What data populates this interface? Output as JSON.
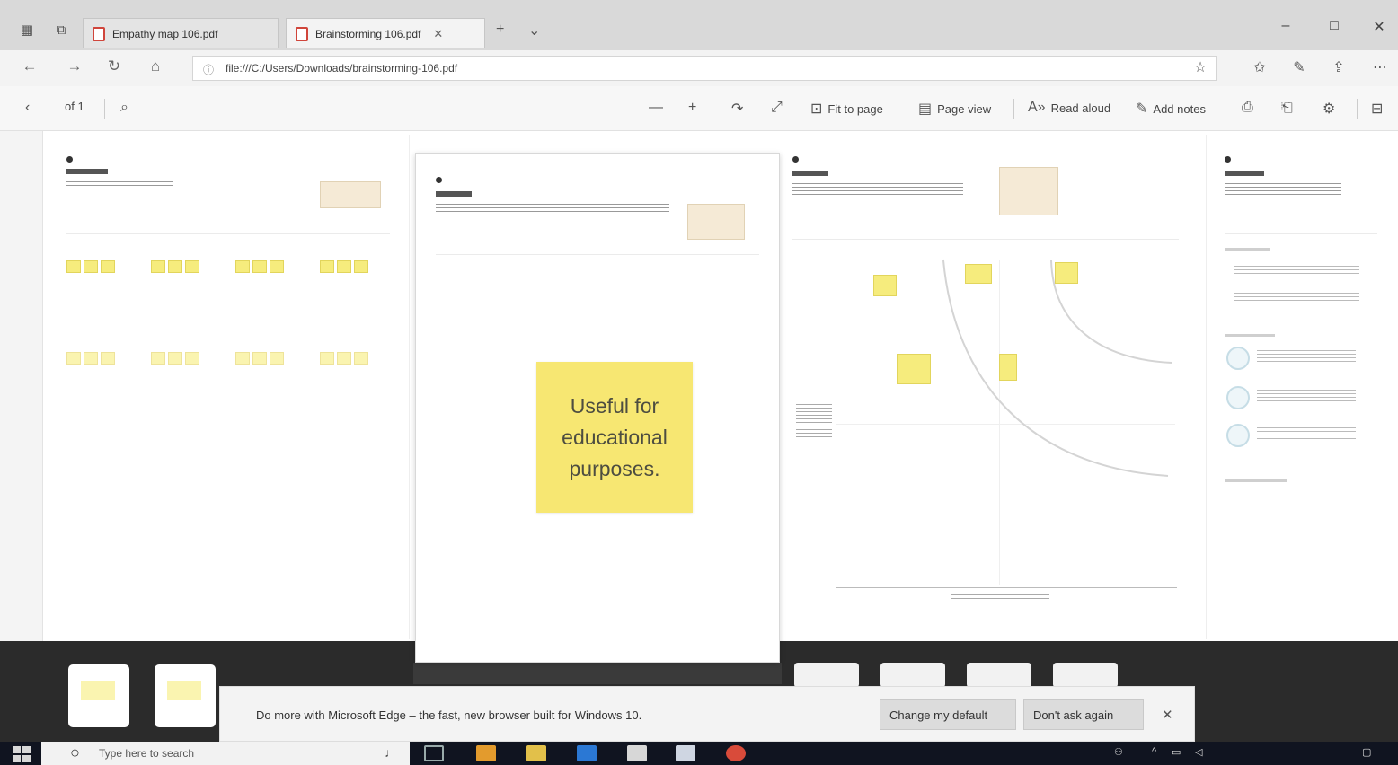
{
  "browser": {
    "tabs": [
      {
        "label": "Empathy map 106.pdf",
        "active": false
      },
      {
        "label": "Brainstorming 106.pdf",
        "active": true
      }
    ],
    "url": "file:///C:/Users/Downloads/brainstorming-106.pdf"
  },
  "pdf_toolbar": {
    "page_counter": "of 1",
    "fit_to_page": "Fit to page",
    "page_view": "Page view",
    "read_aloud": "Read aloud",
    "add_notes": "Add notes"
  },
  "slide2": {
    "big_sticky": "Useful for educational purposes."
  },
  "notification": {
    "message": "Do more with Microsoft Edge – the fast, new browser built for Windows 10.",
    "change_default": "Change my default",
    "dont_ask": "Don't ask again"
  },
  "taskbar": {
    "search_placeholder": "Type here to search"
  },
  "colors": {
    "sticky_yellow": "#f7e772",
    "tabstrip": "#d9d9d9",
    "filmstrip": "#2b2b2b",
    "taskbar": "#101420"
  }
}
